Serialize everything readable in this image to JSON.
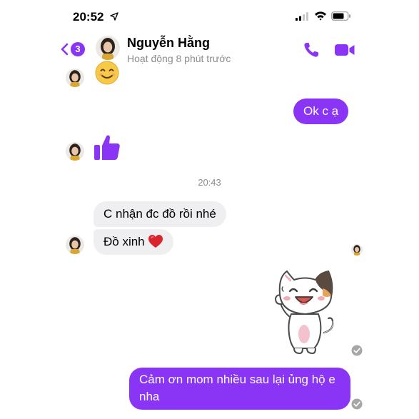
{
  "status_bar": {
    "time": "20:52"
  },
  "header": {
    "back_badge_count": "3",
    "contact_name": "Nguyễn Hằng",
    "contact_status": "Hoạt động 8 phút trước"
  },
  "messages": {
    "outgoing_1": "Ok c ạ",
    "timestamp": "20:43",
    "incoming_1": "C nhận đc đồ rồi nhé",
    "incoming_2": "Đồ xinh",
    "outgoing_2": "Cảm ơn mom nhiều sau lại ủng hộ e nha"
  },
  "colors": {
    "accent": "#8a35f5",
    "incoming_bubble": "#efeff1",
    "timestamp_text": "#8d8d8d"
  },
  "icons": {
    "location": "location-arrow-icon",
    "signal": "signal-icon",
    "wifi": "wifi-icon",
    "battery": "battery-icon",
    "back": "chevron-left-icon",
    "phone": "phone-icon",
    "video": "video-camera-icon",
    "like": "thumbs-up-icon",
    "heart": "heart-icon",
    "smile": "smiling-face-icon",
    "read": "check-circle-icon"
  }
}
